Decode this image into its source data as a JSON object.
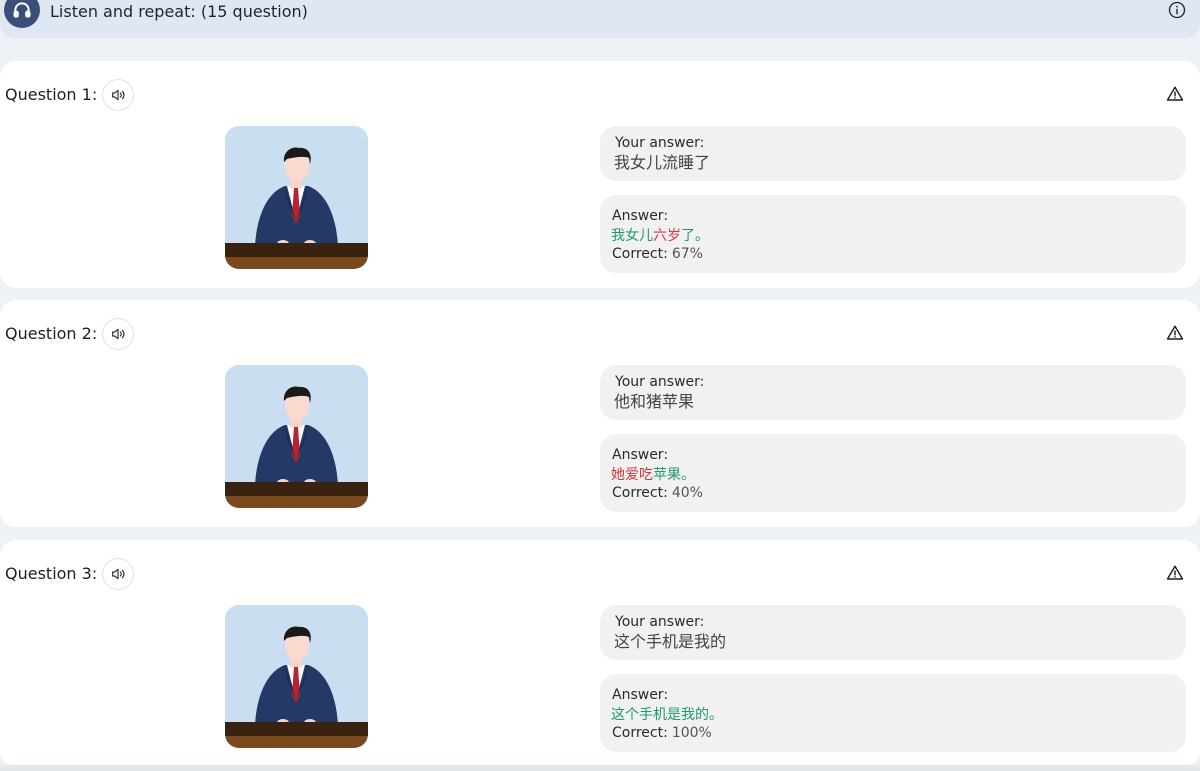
{
  "header": {
    "title": "Listen and repeat: (15 question)",
    "icon": "headphones-icon",
    "info_icon": "info-icon",
    "accent": "#3a4e78"
  },
  "labels": {
    "your_answer": "Your answer:",
    "answer": "Answer:",
    "correct": "Correct:"
  },
  "colors": {
    "correct_char": "#1f9a6d",
    "wrong_char": "#d9363e"
  },
  "questions": [
    {
      "label": "Question 1:",
      "your_answer": "我女儿流睡了",
      "answer_parts": [
        {
          "text": "我女儿",
          "status": "ok"
        },
        {
          "text": "六岁",
          "status": "bad"
        },
        {
          "text": "了。",
          "status": "ok"
        }
      ],
      "correct": "67%"
    },
    {
      "label": "Question 2:",
      "your_answer": "他和猪苹果",
      "answer_parts": [
        {
          "text": "她爱吃",
          "status": "bad"
        },
        {
          "text": "苹果。",
          "status": "ok"
        }
      ],
      "correct": "40%"
    },
    {
      "label": "Question 3:",
      "your_answer": "这个手机是我的",
      "answer_parts": [
        {
          "text": "这个手机是我的。",
          "status": "ok"
        }
      ],
      "correct": "100%"
    }
  ]
}
